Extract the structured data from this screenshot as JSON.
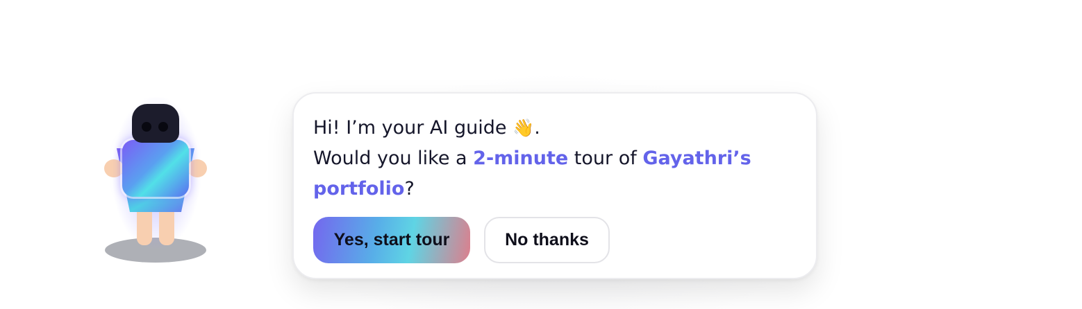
{
  "dialog": {
    "greeting_prefix": "Hi! I’m your AI guide ",
    "greeting_emoji": "👋",
    "greeting_suffix": ".",
    "line2_prefix": "Would you like a ",
    "duration": "2-minute",
    "line2_middle": " tour of ",
    "portfolio_name": "Gayathri’s portfolio",
    "line2_suffix": "?"
  },
  "actions": {
    "primary_label": "Yes, start tour",
    "secondary_label": "No thanks"
  },
  "colors": {
    "highlight": "#6363ea",
    "text": "#15162a",
    "card_border": "#ececef"
  },
  "icons": {
    "avatar": "ai-guide-robot-icon",
    "wave": "waving-hand-emoji"
  }
}
